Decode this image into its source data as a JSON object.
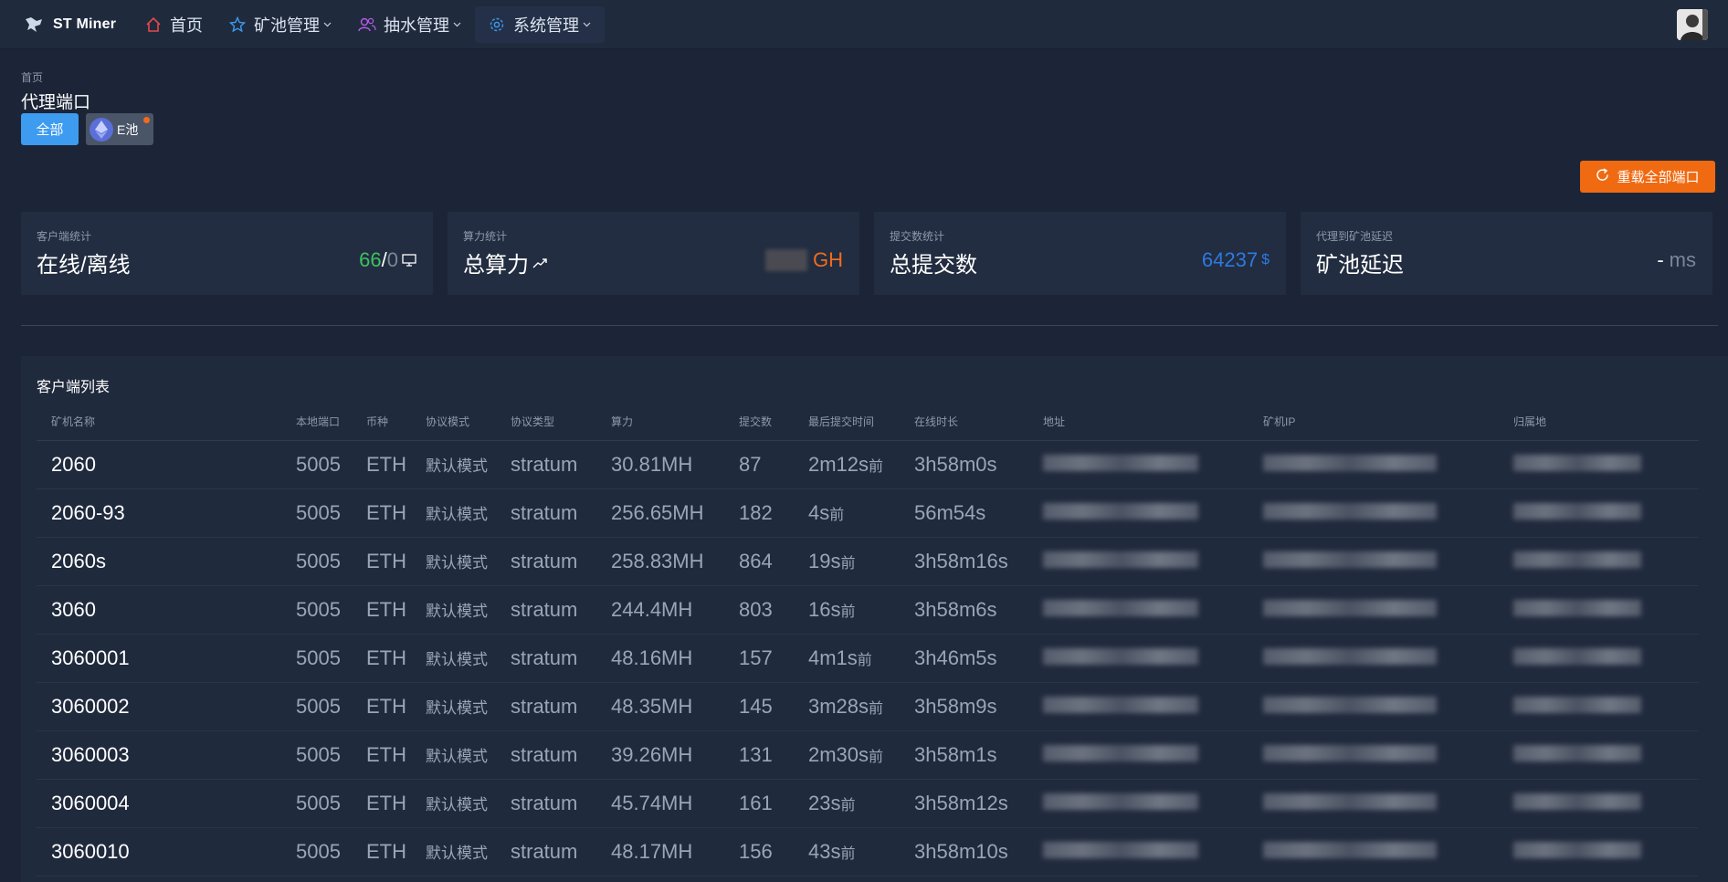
{
  "app": {
    "name": "ST Miner"
  },
  "nav": {
    "items": [
      {
        "label": "首页",
        "icon": "home-icon",
        "color": "#e5484d"
      },
      {
        "label": "矿池管理",
        "icon": "star-icon",
        "color": "#3d9bf0"
      },
      {
        "label": "抽水管理",
        "icon": "users-icon",
        "color": "#b65ce8"
      },
      {
        "label": "系统管理",
        "icon": "gear-icon",
        "color": "#3d9bf0"
      }
    ]
  },
  "breadcrumb": "首页",
  "page_title": "代理端口",
  "filters": {
    "all_label": "全部",
    "pool_label": "E池"
  },
  "reload_button": "重载全部端口",
  "stats": {
    "clients": {
      "caption": "客户端统计",
      "title": "在线/离线",
      "online": "66",
      "sep": "/",
      "offline": "0"
    },
    "hashrate": {
      "caption": "算力统计",
      "title": "总算力",
      "unit": "GH"
    },
    "shares": {
      "caption": "提交数统计",
      "title": "总提交数",
      "value": "64237",
      "unit": "$"
    },
    "latency": {
      "caption": "代理到矿池延迟",
      "title": "矿池延迟",
      "value": "-",
      "unit": "ms"
    }
  },
  "table": {
    "title": "客户端列表",
    "columns": [
      "矿机名称",
      "本地端口",
      "币种",
      "协议模式",
      "协议类型",
      "算力",
      "提交数",
      "最后提交时间",
      "在线时长",
      "地址",
      "矿机IP",
      "归属地"
    ],
    "rows": [
      {
        "name": "2060",
        "port": "5005",
        "coin": "ETH",
        "mode": "默认模式",
        "type": "stratum",
        "hash": "30.81MH",
        "shares": "87",
        "last": "2m12s",
        "last_unit": "前",
        "online": "3h58m0s"
      },
      {
        "name": "2060-93",
        "port": "5005",
        "coin": "ETH",
        "mode": "默认模式",
        "type": "stratum",
        "hash": "256.65MH",
        "shares": "182",
        "last": "4s",
        "last_unit": "前",
        "online": "56m54s"
      },
      {
        "name": "2060s",
        "port": "5005",
        "coin": "ETH",
        "mode": "默认模式",
        "type": "stratum",
        "hash": "258.83MH",
        "shares": "864",
        "last": "19s",
        "last_unit": "前",
        "online": "3h58m16s"
      },
      {
        "name": "3060",
        "port": "5005",
        "coin": "ETH",
        "mode": "默认模式",
        "type": "stratum",
        "hash": "244.4MH",
        "shares": "803",
        "last": "16s",
        "last_unit": "前",
        "online": "3h58m6s"
      },
      {
        "name": "3060001",
        "port": "5005",
        "coin": "ETH",
        "mode": "默认模式",
        "type": "stratum",
        "hash": "48.16MH",
        "shares": "157",
        "last": "4m1s",
        "last_unit": "前",
        "online": "3h46m5s"
      },
      {
        "name": "3060002",
        "port": "5005",
        "coin": "ETH",
        "mode": "默认模式",
        "type": "stratum",
        "hash": "48.35MH",
        "shares": "145",
        "last": "3m28s",
        "last_unit": "前",
        "online": "3h58m9s"
      },
      {
        "name": "3060003",
        "port": "5005",
        "coin": "ETH",
        "mode": "默认模式",
        "type": "stratum",
        "hash": "39.26MH",
        "shares": "131",
        "last": "2m30s",
        "last_unit": "前",
        "online": "3h58m1s"
      },
      {
        "name": "3060004",
        "port": "5005",
        "coin": "ETH",
        "mode": "默认模式",
        "type": "stratum",
        "hash": "45.74MH",
        "shares": "161",
        "last": "23s",
        "last_unit": "前",
        "online": "3h58m12s"
      },
      {
        "name": "3060010",
        "port": "5005",
        "coin": "ETH",
        "mode": "默认模式",
        "type": "stratum",
        "hash": "48.17MH",
        "shares": "156",
        "last": "43s",
        "last_unit": "前",
        "online": "3h58m10s"
      }
    ]
  }
}
